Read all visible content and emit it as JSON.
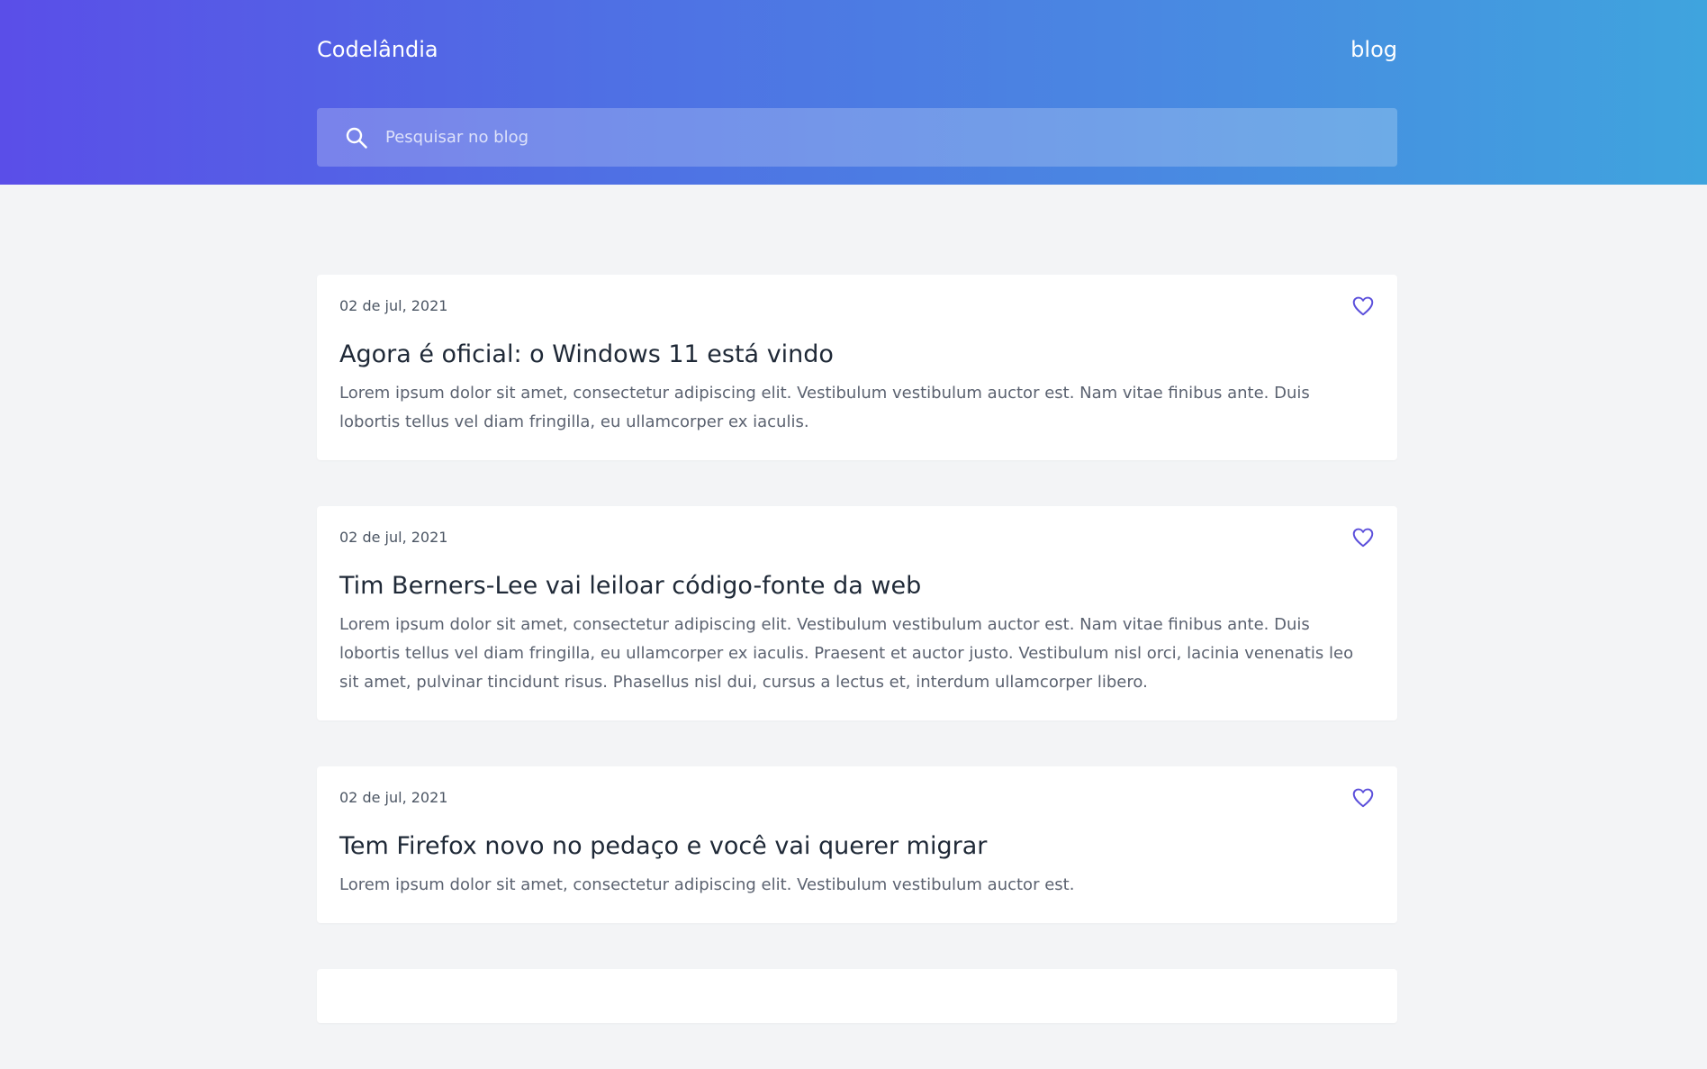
{
  "header": {
    "brand": "Codelândia",
    "nav_link": "blog"
  },
  "search": {
    "placeholder": "Pesquisar no blog",
    "icon": "search-icon"
  },
  "colors": {
    "gradient_start": "#5a4ee8",
    "gradient_end": "#3fa4de",
    "background": "#f3f4f6",
    "heart": "#5b4fdb"
  },
  "posts": [
    {
      "date": "02 de jul, 2021",
      "title": "Agora é oficial: o Windows 11 está vindo",
      "excerpt": "Lorem ipsum dolor sit amet, consectetur adipiscing elit. Vestibulum vestibulum auctor est. Nam vitae finibus ante. Duis lobortis tellus vel diam fringilla, eu ullamcorper ex iaculis.",
      "icon": "heart-icon"
    },
    {
      "date": "02 de jul, 2021",
      "title": "Tim Berners-Lee vai leiloar código-fonte da web",
      "excerpt": "Lorem ipsum dolor sit amet, consectetur adipiscing elit. Vestibulum vestibulum auctor est. Nam vitae finibus ante. Duis lobortis tellus vel diam fringilla, eu ullamcorper ex iaculis. Praesent et auctor justo. Vestibulum nisl orci, lacinia venenatis leo sit amet, pulvinar tincidunt risus. Phasellus nisl dui, cursus a lectus et, interdum ullamcorper libero.",
      "icon": "heart-icon"
    },
    {
      "date": "02 de jul, 2021",
      "title": "Tem Firefox novo no pedaço e você vai querer migrar",
      "excerpt": "Lorem ipsum dolor sit amet, consectetur adipiscing elit. Vestibulum vestibulum auctor est.",
      "icon": "heart-icon"
    }
  ]
}
